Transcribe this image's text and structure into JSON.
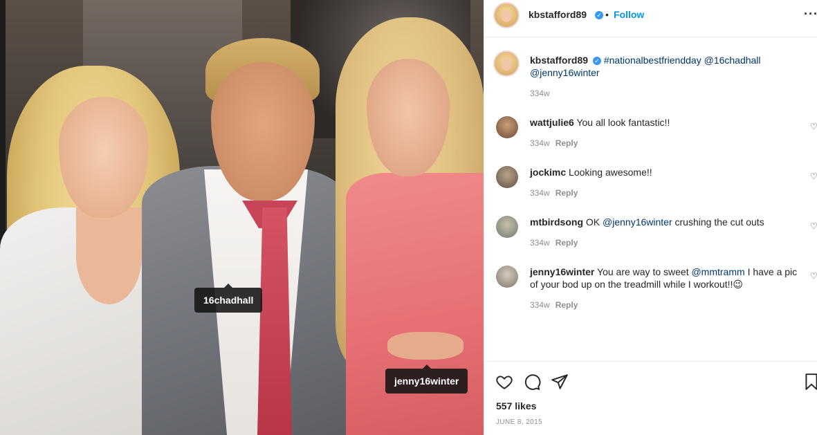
{
  "post": {
    "tags": [
      "16chadhall",
      "jenny16winter"
    ]
  },
  "header": {
    "username": "kbstafford89",
    "verified_mark": "✓",
    "separator": "•",
    "follow_label": "Follow",
    "more_label": "···"
  },
  "caption": {
    "username": "kbstafford89",
    "text_parts": [
      "#nationalbestfriendday",
      "@16chadhall",
      "@jenny16winter"
    ],
    "time": "334w"
  },
  "comments": [
    {
      "username": "wattjulie6",
      "text": "You all look fantastic!!",
      "time": "334w",
      "reply": "Reply"
    },
    {
      "username": "jockimc",
      "text": "Looking awesome!!",
      "time": "334w",
      "reply": "Reply"
    },
    {
      "username": "mtbirdsong",
      "text_before": "OK",
      "mention": "@jenny16winter",
      "text_after": "crushing the cut outs",
      "time": "334w",
      "reply": "Reply"
    },
    {
      "username": "jenny16winter",
      "text_before": "You are way to sweet",
      "mention": "@mmtramm",
      "text_after": "I have a pic of your bod up on the treadmill while I workout!!😉",
      "time": "334w",
      "reply": "Reply"
    }
  ],
  "actions": {
    "icons": [
      "heart-icon",
      "comment-icon",
      "share-icon",
      "bookmark-icon"
    ],
    "likes": "557 likes",
    "date": "JUNE 8, 2015"
  },
  "colors": {
    "link": "#00376b",
    "follow": "#0095f6",
    "verified": "#3897f0",
    "muted": "#8e8e8e"
  }
}
